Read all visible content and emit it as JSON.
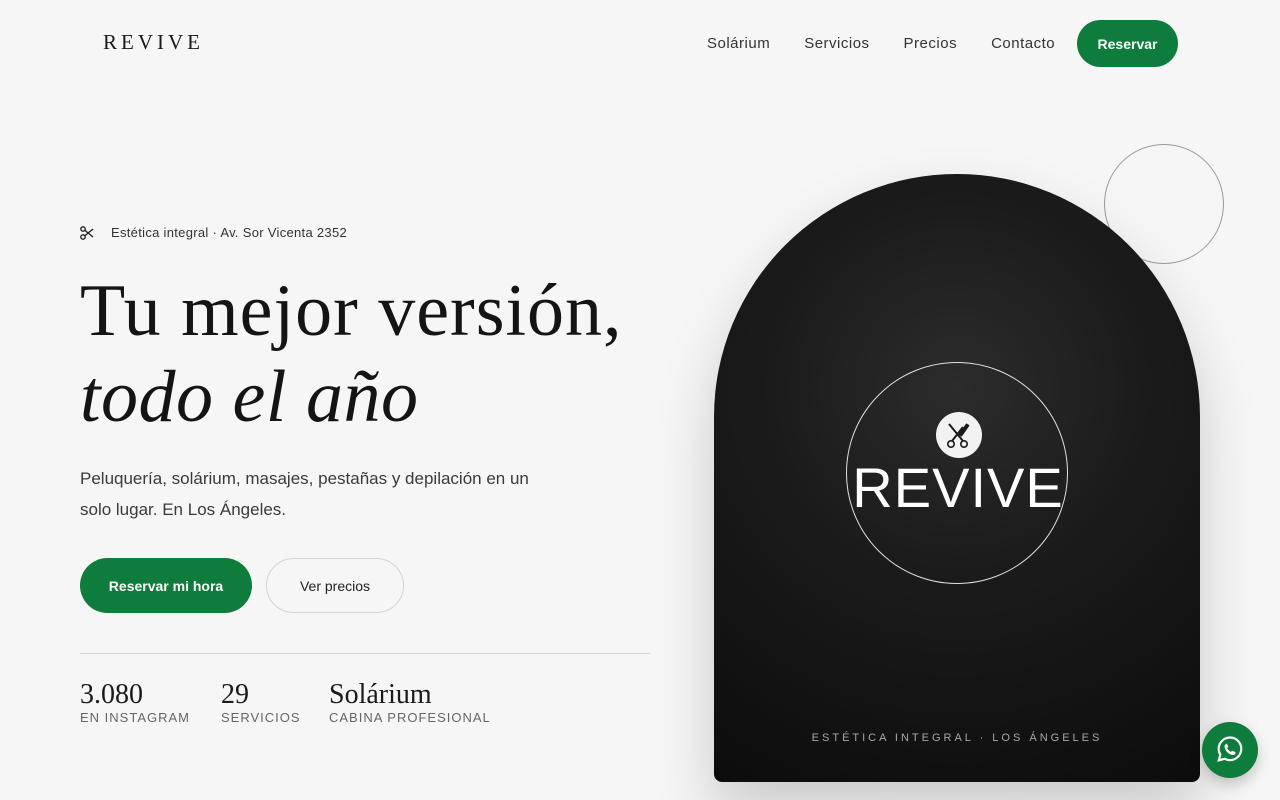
{
  "header": {
    "logo": "REVIVE",
    "nav": [
      "Solárium",
      "Servicios",
      "Precios",
      "Contacto"
    ],
    "cta": "Reservar"
  },
  "hero": {
    "eyebrow": "Estética integral · Av. Sor Vicenta 2352",
    "title_line1": "Tu mejor versión,",
    "title_line2": "todo el año",
    "lead": "Peluquería, solárium, masajes, pestañas y depilación en un solo lugar. En Los Ángeles.",
    "primary_button": "Reservar mi hora",
    "secondary_button": "Ver precios",
    "stats": [
      {
        "value": "3.080",
        "label": "EN INSTAGRAM"
      },
      {
        "value": "29",
        "label": "SERVICIOS"
      },
      {
        "value": "Solárium",
        "label": "CABINA PROFESIONAL"
      }
    ]
  },
  "card": {
    "brand": "REVIVE",
    "caption": "ESTÉTICA INTEGRAL · LOS ÁNGELES"
  },
  "icons": {
    "eyebrow": "scissors-icon",
    "emblem": "scissors-comb-icon",
    "floating": "whatsapp-icon"
  },
  "colors": {
    "accent": "#0e7c3a",
    "background": "#f6f6f6",
    "card": "#141414"
  }
}
